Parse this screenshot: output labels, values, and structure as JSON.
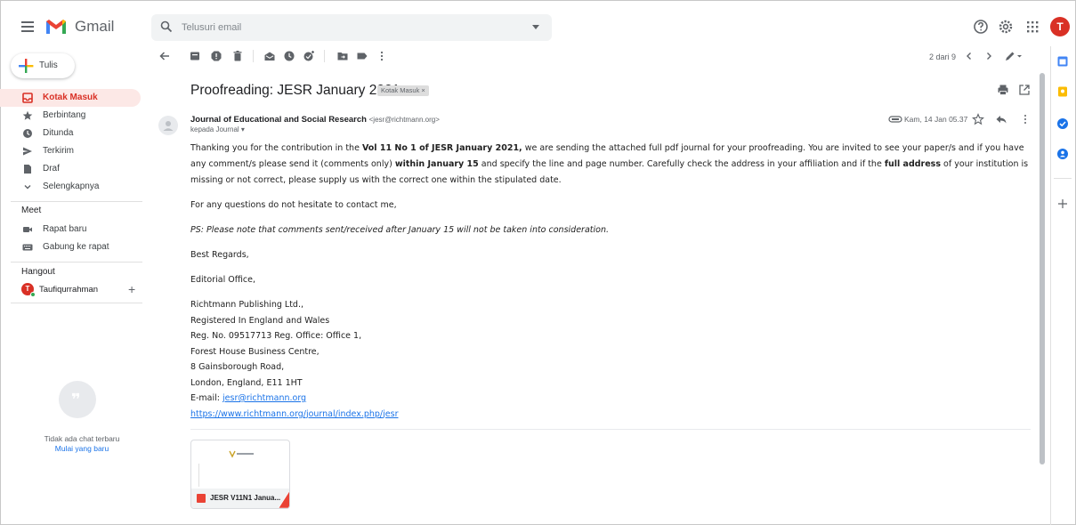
{
  "app": {
    "brand": "Gmail"
  },
  "search": {
    "placeholder": "Telusuri email"
  },
  "account": {
    "initial": "T"
  },
  "sidebar": {
    "compose_label": "Tulis",
    "items": [
      {
        "label": "Kotak Masuk",
        "icon": "inbox-icon",
        "active": true
      },
      {
        "label": "Berbintang",
        "icon": "star-icon"
      },
      {
        "label": "Ditunda",
        "icon": "clock-icon"
      },
      {
        "label": "Terkirim",
        "icon": "send-icon"
      },
      {
        "label": "Draf",
        "icon": "draft-icon"
      },
      {
        "label": "Selengkapnya",
        "icon": "chevron-down-icon"
      }
    ],
    "meet": {
      "title": "Meet",
      "items": [
        {
          "label": "Rapat baru",
          "icon": "video-icon"
        },
        {
          "label": "Gabung ke rapat",
          "icon": "keyboard-icon"
        }
      ]
    },
    "hangout": {
      "title": "Hangout",
      "user_initial": "T",
      "user_name": "Taufiqurrahman",
      "no_chat": "Tidak ada chat terbaru",
      "start_new": "Mulai yang baru"
    }
  },
  "toolbar": {
    "pager": "2 dari 9"
  },
  "email": {
    "subject": "Proofreading: JESR January 2021",
    "label": "Kotak Masuk ×",
    "sender_name": "Journal of Educational and Social Research",
    "sender_email": "<jesr@richtmann.org>",
    "to": "kepada Journal ▾",
    "date": "Kam, 14 Jan 05.37",
    "body": {
      "p1_a": "Thanking you for the contribution in the ",
      "p1_b": "Vol 11 No 1 of JESR January 2021,",
      "p1_c": " we are sending the attached full pdf journal for your proofreading. You are invited to see your paper/s and if you have any comment/s please send it (comments only) ",
      "p1_d": "within January 15",
      "p1_e": " and specify the line and page number. Carefully check the address in your affiliation and if the ",
      "p1_f": "full address",
      "p1_g": " of your institution is missing or not correct, please supply us with the correct one within the stipulated date.",
      "p2": "For any questions do not hesitate to contact me,",
      "p3": "PS: Please note that comments sent/received after January 15 will not be taken into consideration.",
      "p4": "Best Regards,",
      "p5": "Editorial Office,",
      "addr1": "Richtmann Publishing Ltd.,",
      "addr2": "Registered In England and Wales",
      "addr3": "Reg. No. 09517713  Reg. Office: Office 1,",
      "addr4": "Forest House Business Centre,",
      "addr5": "8 Gainsborough Road,",
      "addr6": "London, England, E11 1HT",
      "email_prefix": "E-mail: ",
      "email_link": "jesr@richtmann.org",
      "url": "https://www.richtmann.org/journal/index.php/jesr"
    },
    "attachment": {
      "name": "JESR V11N1 Janua..."
    }
  },
  "colors": {
    "accent": "#d93025",
    "link": "#1a73e8",
    "active_bg": "#fce8e6"
  }
}
